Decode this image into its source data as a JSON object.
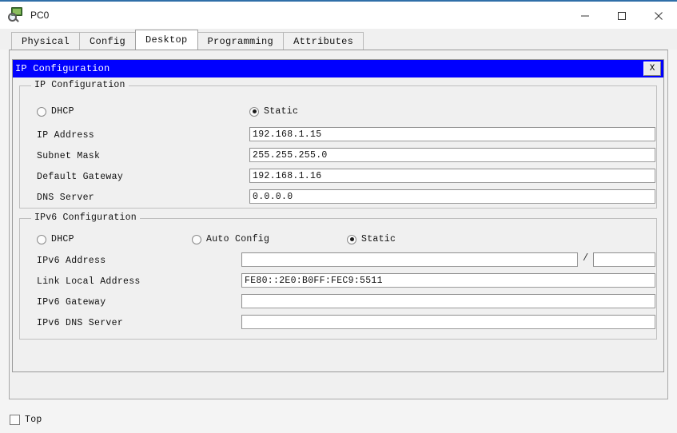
{
  "window": {
    "title": "PC0",
    "icon": "pc-magnifier-icon",
    "minimize_label": "–",
    "maximize_label": "☐",
    "close_label": "✕"
  },
  "tabs": [
    {
      "label": "Physical",
      "active": false
    },
    {
      "label": "Config",
      "active": false
    },
    {
      "label": "Desktop",
      "active": true
    },
    {
      "label": "Programming",
      "active": false
    },
    {
      "label": "Attributes",
      "active": false
    }
  ],
  "ip_window": {
    "titlebar_text": "IP Configuration",
    "titlebar_color": "#0000ff",
    "close_button_label": "X"
  },
  "ipv4": {
    "legend": "IP Configuration",
    "modes": [
      {
        "label": "DHCP",
        "selected": false
      },
      {
        "label": "Static",
        "selected": true
      }
    ],
    "fields": [
      {
        "label": "IP Address",
        "value": "192.168.1.15"
      },
      {
        "label": "Subnet Mask",
        "value": "255.255.255.0"
      },
      {
        "label": "Default Gateway",
        "value": "192.168.1.16"
      },
      {
        "label": "DNS Server",
        "value": "0.0.0.0"
      }
    ]
  },
  "ipv6": {
    "legend": "IPv6 Configuration",
    "modes": [
      {
        "label": "DHCP",
        "selected": false
      },
      {
        "label": "Auto Config",
        "selected": false
      },
      {
        "label": "Static",
        "selected": true
      }
    ],
    "address_label": "IPv6 Address",
    "address_value": "",
    "prefix_separator": "/",
    "prefix_value": "",
    "fields": [
      {
        "label": "Link Local Address",
        "value": "FE80::2E0:B0FF:FEC9:5511"
      },
      {
        "label": "IPv6 Gateway",
        "value": ""
      },
      {
        "label": "IPv6 DNS Server",
        "value": ""
      }
    ]
  },
  "footer": {
    "top_checkbox_label": "Top",
    "top_checkbox_checked": false
  }
}
